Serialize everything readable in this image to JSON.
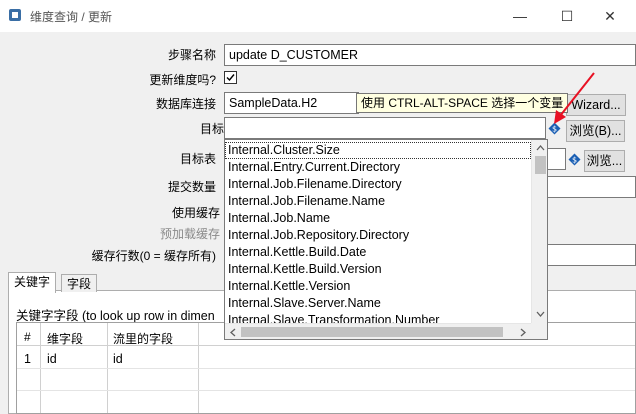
{
  "window": {
    "title": "维度查询 / 更新",
    "minimize_glyph": "—",
    "maximize_glyph": "☐",
    "close_glyph": "✕",
    "top_mark": "◦"
  },
  "form": {
    "step_name_label": "步骤名称",
    "step_name_value": "update D_CUSTOMER",
    "update_dim_label": "更新维度吗?",
    "update_dim_checked": true,
    "db_conn_label": "数据库连接",
    "db_conn_value": "SampleData.H2",
    "wizard_button": "Wizard...",
    "target_schema_label": "目标模式",
    "target_schema_value": "",
    "browse_b_button": "浏览(B)...",
    "target_table_label": "目标表",
    "browse_button": "浏览...",
    "commit_size_label": "提交数量",
    "use_cache_label": "使用缓存",
    "preload_cache_label": "预加载缓存",
    "cache_rows_label": "缓存行数(0 = 缓存所有)"
  },
  "tooltip": {
    "text": "使用 CTRL-ALT-SPACE 选择一个变量"
  },
  "dropdown": {
    "items": [
      "Internal.Cluster.Size",
      "Internal.Entry.Current.Directory",
      "Internal.Job.Filename.Directory",
      "Internal.Job.Filename.Name",
      "Internal.Job.Name",
      "Internal.Job.Repository.Directory",
      "Internal.Kettle.Build.Date",
      "Internal.Kettle.Build.Version",
      "Internal.Kettle.Version",
      "Internal.Slave.Server.Name",
      "Internal.Slave.Transformation.Number"
    ],
    "selected_index": 0
  },
  "tabs": [
    {
      "label": "关键字"
    },
    {
      "label": "字段"
    }
  ],
  "keys": {
    "desc": "关键字字段 (to look up row in dimen",
    "columns": [
      "#",
      "维字段",
      "流里的字段"
    ],
    "rows": [
      {
        "num": "1",
        "dim": "id",
        "stream": "id"
      }
    ]
  },
  "colors": {
    "accent": "#0078d7",
    "tooltip_bg": "#ffffe1",
    "arrow": "#e81123",
    "var_icon": "#1a5fb4"
  },
  "icons": {
    "check": "check-icon",
    "variable": "dollar-diamond-icon",
    "arrow": "red-arrow-icon"
  }
}
